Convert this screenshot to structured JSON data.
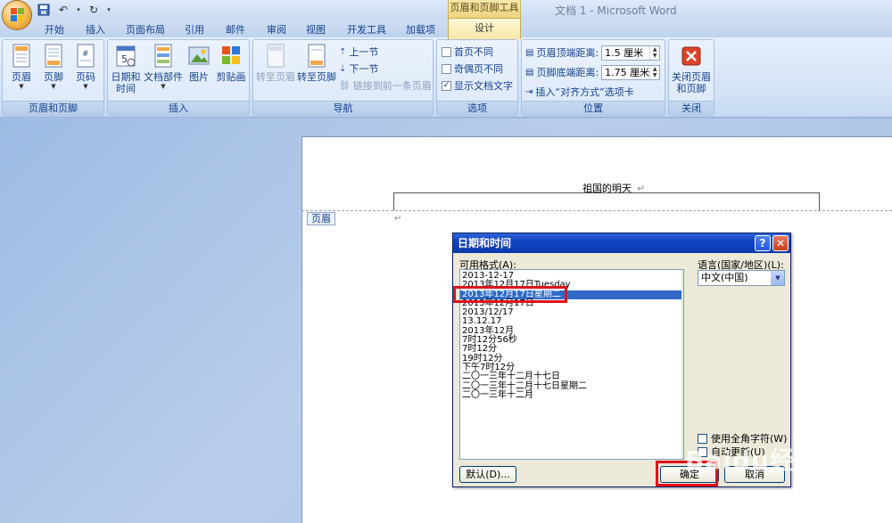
{
  "window": {
    "title": "文档 1 - Microsoft Word",
    "contextual_tab_group": "页眉和页脚工具"
  },
  "tabs": [
    {
      "label": "开始"
    },
    {
      "label": "插入"
    },
    {
      "label": "页面布局"
    },
    {
      "label": "引用"
    },
    {
      "label": "邮件"
    },
    {
      "label": "审阅"
    },
    {
      "label": "视图"
    },
    {
      "label": "开发工具"
    },
    {
      "label": "加载项"
    },
    {
      "label": "设计",
      "active": true
    }
  ],
  "ribbon": {
    "groups": {
      "header_footer": {
        "label": "页眉和页脚",
        "buttons": [
          {
            "label": "页眉"
          },
          {
            "label": "页脚"
          },
          {
            "label": "页码"
          }
        ]
      },
      "insert": {
        "label": "插入",
        "buttons": [
          {
            "label": "日期和\n时间"
          },
          {
            "label": "文档部件"
          },
          {
            "label": "图片"
          },
          {
            "label": "剪贴画"
          }
        ]
      },
      "navigation": {
        "label": "导航",
        "buttons": [
          {
            "label": "转至页眉"
          },
          {
            "label": "转至页脚"
          }
        ],
        "small": [
          {
            "label": "上一节"
          },
          {
            "label": "下一节"
          },
          {
            "label": "链接到前一条页眉"
          }
        ]
      },
      "options": {
        "label": "选项",
        "checks": [
          {
            "label": "首页不同",
            "checked": false
          },
          {
            "label": "奇偶页不同",
            "checked": false
          },
          {
            "label": "显示文档文字",
            "checked": true
          }
        ]
      },
      "position": {
        "label": "位置",
        "header_top_label": "页眉顶端距离:",
        "header_top_value": "1.5 厘米",
        "footer_bottom_label": "页脚底端距离:",
        "footer_bottom_value": "1.75 厘米",
        "insert_align_tab": "插入“对齐方式”选项卡"
      },
      "close": {
        "label": "关闭",
        "button": "关闭页眉\n和页脚"
      }
    }
  },
  "document": {
    "header_text": "祖国的明天",
    "paragraph_mark": "↵",
    "header_tag": "页眉"
  },
  "dialog": {
    "title": "日期和时间",
    "help_symbol": "?",
    "close_symbol": "✕",
    "formats_label": "可用格式(A):",
    "language_label": "语言(国家/地区)(L):",
    "language_value": "中文(中国)",
    "formats": [
      "2013-12-17",
      "2013年12月17日Tuesday",
      "2013年12月17日星期二",
      "2013年12月17日",
      "2013/12/17",
      "13.12.17",
      "2013年12月",
      "7时12分56秒",
      "7时12分",
      "19时12分",
      "下午7时12分",
      "二〇一三年十二月十七日",
      "二〇一三年十二月十七日星期二",
      "二〇一三年十二月"
    ],
    "selected_index": 2,
    "use_fullwidth": "使用全角字符(W)",
    "auto_update": "自动更新(U)",
    "default_button": "默认(D)...",
    "ok_button": "确定",
    "cancel_button": "取消"
  },
  "watermark": {
    "text": "Baidu经验",
    "url": "jingyan.baidu.com"
  },
  "colors": {
    "accent_red": "#e0101a",
    "selection": "#316ac5",
    "ribbon_text": "#15428b"
  }
}
